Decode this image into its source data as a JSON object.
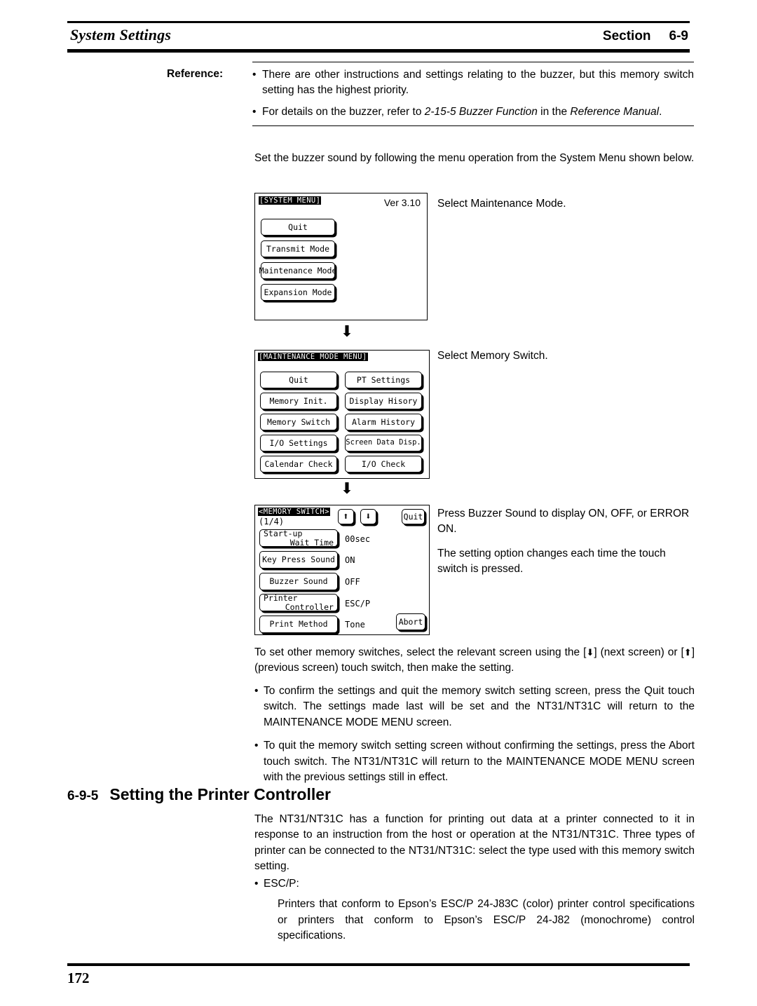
{
  "header": {
    "title": "System Settings",
    "section_label": "Section",
    "section_number": "6-9"
  },
  "reference": {
    "label": "Reference:",
    "bullet": "•",
    "items": [
      {
        "pre": "There are other instructions and settings relating to the buzzer, but this memory switch setting has the highest priority.",
        "italic_1": "",
        "mid": "",
        "italic_2": "",
        "post": ""
      },
      {
        "pre": "For details on the buzzer, refer to ",
        "italic_1": "2-15-5 Buzzer Function",
        "mid": " in the ",
        "italic_2": "Reference Manual",
        "post": "."
      }
    ]
  },
  "intro": "Set the buzzer sound by following the menu operation from the System Menu shown below.",
  "screens": {
    "system_menu": {
      "title": "[SYSTEM MENU]",
      "version": "Ver 3.10",
      "buttons": [
        "Quit",
        "Transmit Mode",
        "Maintenance Mode",
        "Expansion Mode"
      ]
    },
    "maintenance_menu": {
      "title": "[MAINTENANCE MODE MENU]",
      "left_buttons": [
        "Quit",
        "Memory Init.",
        "Memory Switch",
        "I/O Settings",
        "Calendar Check"
      ],
      "right_buttons": [
        "PT Settings",
        "Display Hisory",
        "Alarm History",
        "Screen Data Disp.",
        "I/O Check"
      ]
    },
    "memory_switch": {
      "title": "<MEMORY SWITCH>",
      "page_indicator": "(1/4)",
      "up_arrow": "⬆",
      "down_arrow": "⬇",
      "quit_label": "Quit",
      "abort_label": "Abort",
      "rows": [
        {
          "label_line1": "Start-up",
          "label_line2": "Wait Time",
          "value": "00sec"
        },
        {
          "label_line1": "Key Press Sound",
          "label_line2": "",
          "value": "ON"
        },
        {
          "label_line1": "Buzzer Sound",
          "label_line2": "",
          "value": "OFF"
        },
        {
          "label_line1": "Printer",
          "label_line2": "Controller",
          "value": "ESC/P"
        },
        {
          "label_line1": "Print Method",
          "label_line2": "",
          "value": "Tone"
        }
      ]
    }
  },
  "connector_arrow": "⬇",
  "callouts": {
    "step1": "Select Maintenance Mode.",
    "step2": "Select Memory Switch.",
    "step3_line1": "Press Buzzer Sound to display ON, OFF, or ERROR ON.",
    "step3_line2": "The setting option changes each time the touch switch is pressed."
  },
  "body": {
    "other_switches_pre": "To set other memory switches, select the relevant screen using the [",
    "other_switches_mid": "] (next screen) or [",
    "other_switches_post": "] (previous screen) touch switch, then make the setting.",
    "down_key": "⬇",
    "up_key": "⬆",
    "bullet": "•",
    "bullets": [
      "To confirm the settings and quit the memory switch setting screen, press the Quit touch switch. The settings made last will be set and the NT31/NT31C will return to the MAINTENANCE MODE MENU screen.",
      "To quit the memory switch setting screen without confirming the settings, press the Abort touch switch. The NT31/NT31C will return to the MAINTENANCE MODE MENU screen with the previous settings still in effect."
    ]
  },
  "section": {
    "number": "6-9-5",
    "title": "Setting the Printer Controller",
    "paragraph": "The NT31/NT31C has a function for printing out data at a printer connected to it in response to an instruction from the host or operation at the NT31/NT31C. Three types of printer can be connected to the NT31/NT31C: select the type used with this memory switch setting.",
    "escp_label": "ESC/P:",
    "escp_text": "Printers that conform to Epson’s ESC/P 24-J83C (color) printer control specifications or printers that conform to Epson’s ESC/P 24-J82 (monochrome) control specifications."
  },
  "footer": {
    "page_number": "172"
  }
}
